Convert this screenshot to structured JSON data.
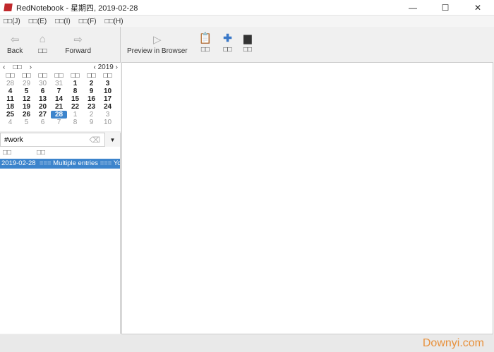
{
  "window": {
    "title": "RedNotebook - 星期四, 2019-02-28",
    "controls": [
      "—",
      "☐",
      "✕"
    ]
  },
  "menu": [
    "□□(J)",
    "□□(E)",
    "□□(I)",
    "□□(F)",
    "□□(H)"
  ],
  "nav_toolbar": [
    {
      "label": "Back",
      "icon": "back-arrow-icon"
    },
    {
      "label": "□□",
      "icon": "home-icon"
    },
    {
      "label": "Forward",
      "icon": "forward-arrow-icon"
    }
  ],
  "main_toolbar": [
    {
      "label": "Preview in Browser",
      "icon": "play-icon"
    },
    {
      "label": "□□",
      "icon": "clipboard-icon"
    },
    {
      "label": "□□",
      "icon": "plus-icon"
    },
    {
      "label": "□□",
      "icon": "printer-icon"
    }
  ],
  "calendar": {
    "month": "□□",
    "year": "2019",
    "weekdays": [
      "□□",
      "□□",
      "□□",
      "□□",
      "□□",
      "□□",
      "□□"
    ],
    "days": [
      [
        "28",
        "d"
      ],
      [
        "29",
        "d"
      ],
      [
        "30",
        "d"
      ],
      [
        "31",
        "d"
      ],
      [
        "1",
        ""
      ],
      [
        "2",
        ""
      ],
      [
        "3",
        ""
      ],
      [
        "4",
        ""
      ],
      [
        "5",
        ""
      ],
      [
        "6",
        ""
      ],
      [
        "7",
        ""
      ],
      [
        "8",
        ""
      ],
      [
        "9",
        ""
      ],
      [
        "10",
        ""
      ],
      [
        "11",
        ""
      ],
      [
        "12",
        ""
      ],
      [
        "13",
        ""
      ],
      [
        "14",
        ""
      ],
      [
        "15",
        ""
      ],
      [
        "16",
        ""
      ],
      [
        "17",
        ""
      ],
      [
        "18",
        ""
      ],
      [
        "19",
        ""
      ],
      [
        "20",
        ""
      ],
      [
        "21",
        ""
      ],
      [
        "22",
        ""
      ],
      [
        "23",
        ""
      ],
      [
        "24",
        ""
      ],
      [
        "25",
        ""
      ],
      [
        "26",
        ""
      ],
      [
        "27",
        ""
      ],
      [
        "28",
        "s"
      ],
      [
        "1",
        "d"
      ],
      [
        "2",
        "d"
      ],
      [
        "3",
        "d"
      ],
      [
        "4",
        "d"
      ],
      [
        "5",
        "d"
      ],
      [
        "6",
        "d"
      ],
      [
        "7",
        "d"
      ],
      [
        "8",
        "d"
      ],
      [
        "9",
        "d"
      ],
      [
        "10",
        "d"
      ]
    ]
  },
  "search": {
    "value": "#work"
  },
  "list": {
    "headers": [
      "□□",
      "□□"
    ],
    "rows": [
      {
        "date": "2019-02-28",
        "text": "=== Multiple entries === You"
      }
    ]
  },
  "watermark": "Downyi.com"
}
